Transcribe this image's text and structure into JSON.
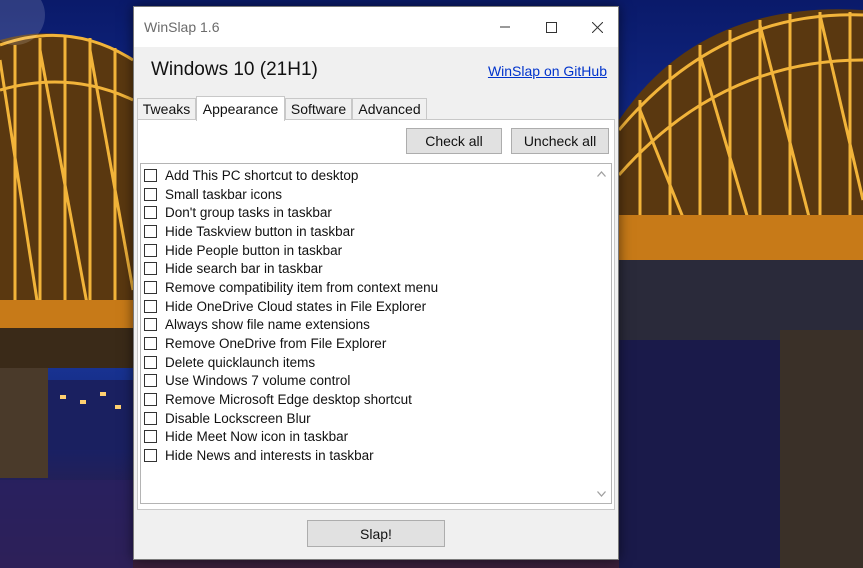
{
  "window": {
    "title": "WinSlap 1.6",
    "os_version": "Windows 10 (21H1)",
    "github_link": "WinSlap on GitHub"
  },
  "tabs": [
    {
      "label": "Tweaks",
      "active": false
    },
    {
      "label": "Appearance",
      "active": true
    },
    {
      "label": "Software",
      "active": false
    },
    {
      "label": "Advanced",
      "active": false
    }
  ],
  "buttons": {
    "check_all": "Check all",
    "uncheck_all": "Uncheck all",
    "slap": "Slap!"
  },
  "items": [
    {
      "label": "Add This PC shortcut to desktop",
      "checked": false
    },
    {
      "label": "Small taskbar icons",
      "checked": false
    },
    {
      "label": "Don't group tasks in taskbar",
      "checked": false
    },
    {
      "label": "Hide Taskview button in taskbar",
      "checked": false
    },
    {
      "label": "Hide People button in taskbar",
      "checked": false
    },
    {
      "label": "Hide search bar in taskbar",
      "checked": false
    },
    {
      "label": "Remove compatibility item from context menu",
      "checked": false
    },
    {
      "label": "Hide OneDrive Cloud states in File Explorer",
      "checked": false
    },
    {
      "label": "Always show file name extensions",
      "checked": false
    },
    {
      "label": "Remove OneDrive from File Explorer",
      "checked": false
    },
    {
      "label": "Delete quicklaunch items",
      "checked": false
    },
    {
      "label": "Use Windows 7 volume control",
      "checked": false
    },
    {
      "label": "Remove Microsoft Edge desktop shortcut",
      "checked": false
    },
    {
      "label": "Disable Lockscreen Blur",
      "checked": false
    },
    {
      "label": "Hide Meet Now icon in taskbar",
      "checked": false
    },
    {
      "label": "Hide News and interests in taskbar",
      "checked": false
    }
  ],
  "icons": {
    "minimize": "minimize-icon",
    "maximize": "maximize-icon",
    "close": "close-icon",
    "scroll_up": "chevron-up-icon",
    "scroll_down": "chevron-down-icon"
  },
  "colors": {
    "link": "#0033cc",
    "window_bg": "#f0f0f0",
    "button_bg": "#e1e1e1"
  }
}
